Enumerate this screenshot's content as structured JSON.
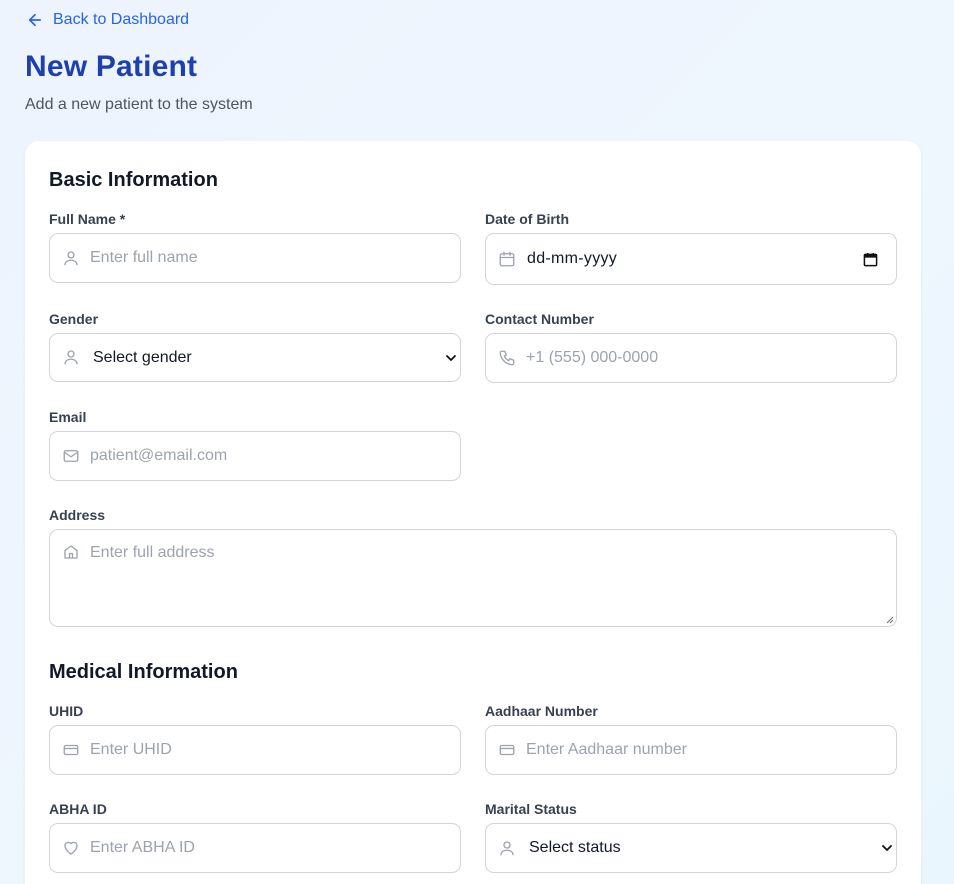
{
  "nav": {
    "back_label": "Back to Dashboard"
  },
  "header": {
    "title": "New Patient",
    "subtitle": "Add a new patient to the system"
  },
  "sections": {
    "basic": {
      "title": "Basic Information"
    },
    "medical": {
      "title": "Medical Information"
    }
  },
  "fields": {
    "full_name": {
      "label": "Full Name *",
      "placeholder": "Enter full name",
      "icon": "user-icon"
    },
    "dob": {
      "label": "Date of Birth",
      "value": "dd-mm-yyyy",
      "icon": "calendar-icon"
    },
    "gender": {
      "label": "Gender",
      "value": "Select gender",
      "icon": "user-icon"
    },
    "contact": {
      "label": "Contact Number",
      "placeholder": "+1 (555) 000-0000",
      "icon": "phone-icon"
    },
    "email": {
      "label": "Email",
      "placeholder": "patient@email.com",
      "icon": "mail-icon"
    },
    "address": {
      "label": "Address",
      "placeholder": "Enter full address",
      "icon": "home-icon"
    },
    "uhid": {
      "label": "UHID",
      "placeholder": "Enter UHID",
      "icon": "card-icon"
    },
    "aadhaar": {
      "label": "Aadhaar Number",
      "placeholder": "Enter Aadhaar number",
      "icon": "card-icon"
    },
    "abha": {
      "label": "ABHA ID",
      "placeholder": "Enter ABHA ID",
      "icon": "heart-icon"
    },
    "marital": {
      "label": "Marital Status",
      "value": "Select status",
      "icon": "user-icon"
    }
  },
  "colors": {
    "accent": "#2563eb",
    "title": "#1e40af",
    "border": "#d1d5db",
    "placeholder": "#9ca3af"
  }
}
